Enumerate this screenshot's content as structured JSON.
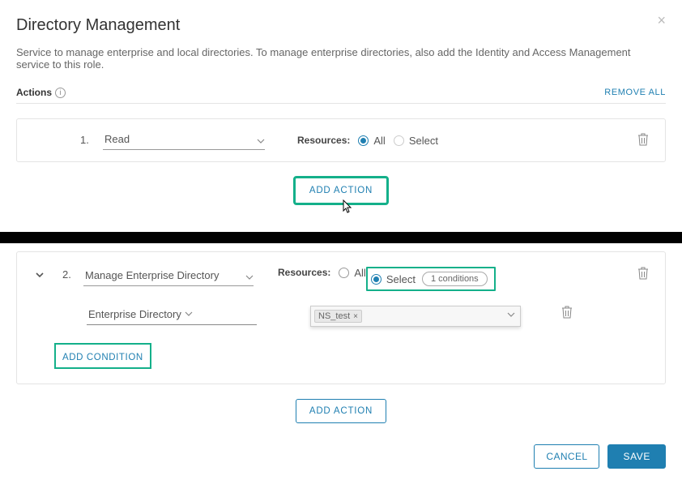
{
  "title": "Directory Management",
  "description": "Service to manage enterprise and local directories. To manage enterprise directories, also add the Identity and Access Management service to this role.",
  "actions_label": "Actions",
  "remove_all": "REMOVE ALL",
  "resources_label": "Resources:",
  "add_action": "ADD ACTION",
  "add_condition": "ADD CONDITION",
  "radio_all": "All",
  "radio_select": "Select",
  "footer": {
    "cancel": "CANCEL",
    "save": "SAVE"
  },
  "action1": {
    "index": "1.",
    "action": "Read",
    "resources_mode": "all"
  },
  "action2": {
    "index": "2.",
    "action": "Manage Enterprise Directory",
    "resources_mode": "select",
    "conditions_count": "1 conditions",
    "condition": {
      "attribute": "Enterprise Directory",
      "tags": [
        "NS_test"
      ]
    }
  }
}
